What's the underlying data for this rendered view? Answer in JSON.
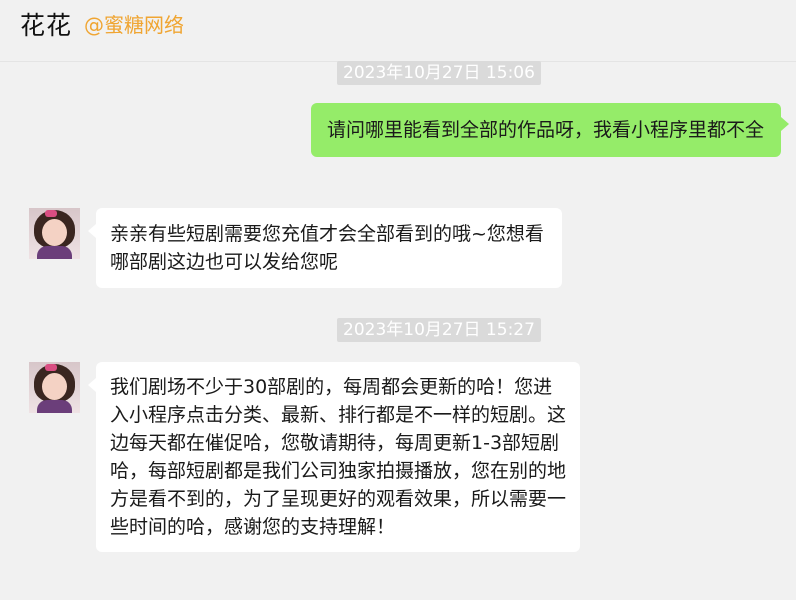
{
  "header": {
    "contact_name": "花花",
    "org_tag": "@蜜糖网络"
  },
  "messages": [
    {
      "type": "timestamp",
      "text": "2023年10月27日 15:06"
    },
    {
      "type": "message",
      "side": "right",
      "text": "请问哪里能看到全部的作品呀，我看小程序里都不全"
    },
    {
      "type": "message",
      "side": "left",
      "text": "亲亲有些短剧需要您充值才会全部看到的哦~您想看哪部剧这边也可以发给您呢"
    },
    {
      "type": "timestamp",
      "text": "2023年10月27日 15:27"
    },
    {
      "type": "message",
      "side": "left",
      "text": "我们剧场不少于30部剧的，每周都会更新的哈！您进入小程序点击分类、最新、排行都是不一样的短剧。这边每天都在催促哈，您敬请期待，每周更新1-3部短剧哈，每部短剧都是我们公司独家拍摄播放，您在别的地方是看不到的，为了呈现更好的观看效果，所以需要一些时间的哈，感谢您的支持理解！"
    }
  ]
}
